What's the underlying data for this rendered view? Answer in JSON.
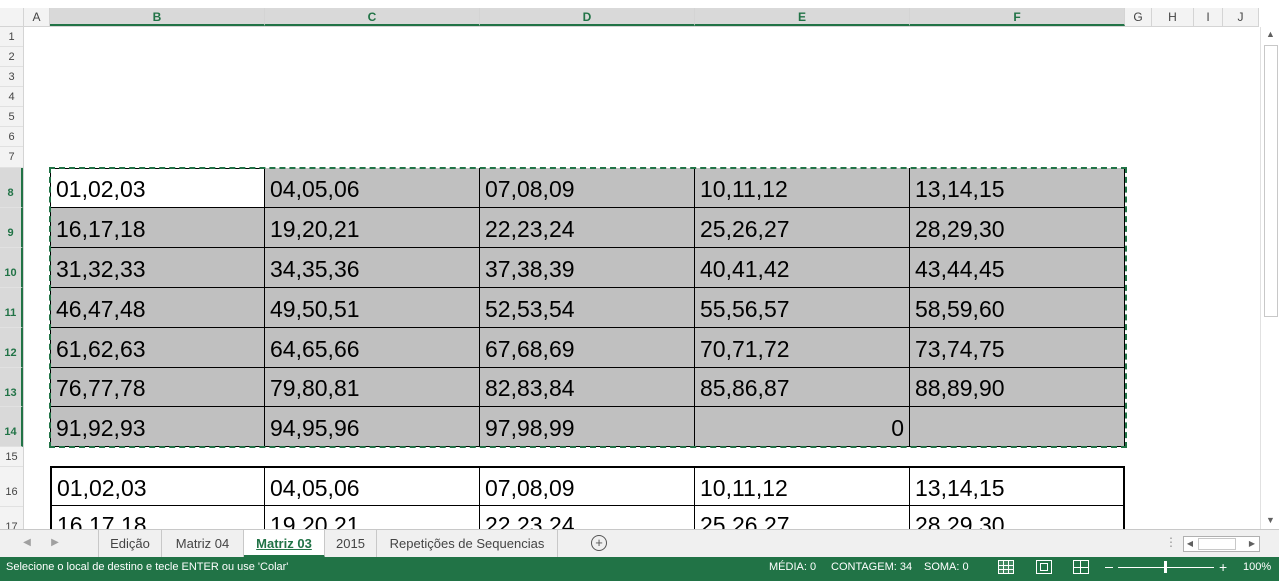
{
  "columns": [
    "A",
    "B",
    "C",
    "D",
    "E",
    "F",
    "G",
    "H",
    "I",
    "J"
  ],
  "rows": [
    "1",
    "2",
    "3",
    "4",
    "5",
    "6",
    "7",
    "8",
    "9",
    "10",
    "11",
    "12",
    "13",
    "14",
    "15",
    "16",
    "17"
  ],
  "table1": [
    [
      "01,02,03",
      "04,05,06",
      "07,08,09",
      "10,11,12",
      "13,14,15"
    ],
    [
      "16,17,18",
      "19,20,21",
      "22,23,24",
      "25,26,27",
      "28,29,30"
    ],
    [
      "31,32,33",
      "34,35,36",
      "37,38,39",
      "40,41,42",
      "43,44,45"
    ],
    [
      "46,47,48",
      "49,50,51",
      "52,53,54",
      "55,56,57",
      "58,59,60"
    ],
    [
      "61,62,63",
      "64,65,66",
      "67,68,69",
      "70,71,72",
      "73,74,75"
    ],
    [
      "76,77,78",
      "79,80,81",
      "82,83,84",
      "85,86,87",
      "88,89,90"
    ],
    [
      "91,92,93",
      "94,95,96",
      "97,98,99",
      "0",
      ""
    ]
  ],
  "table2": [
    [
      "01,02,03",
      "04,05,06",
      "07,08,09",
      "10,11,12",
      "13,14,15"
    ],
    [
      "16,17,18",
      "19,20,21",
      "22,23,24",
      "25,26,27",
      "28,29,30"
    ]
  ],
  "tabs": [
    "Edição",
    "Matriz 04",
    "Matriz 03",
    "2015",
    "Repetições de Sequencias"
  ],
  "active_tab": "Matriz 03",
  "status": {
    "message": "Selecione o local de destino e tecle ENTER ou use 'Colar'",
    "media": "MÉDIA: 0",
    "contagem": "CONTAGEM: 34",
    "soma": "SOMA: 0",
    "zoom": "100%"
  },
  "colors": {
    "accent": "#217346",
    "selection_fill": "#c0c0c0"
  },
  "icons": [
    "add-sheet-icon",
    "normal-view-icon",
    "page-layout-icon",
    "page-break-icon",
    "zoom-out-icon",
    "zoom-in-icon"
  ]
}
